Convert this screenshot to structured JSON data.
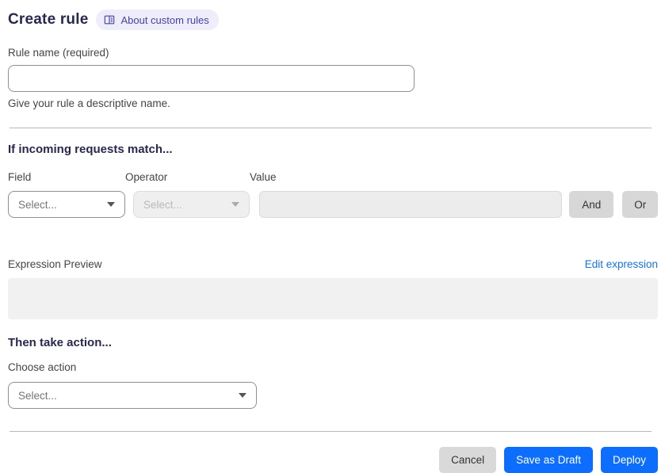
{
  "header": {
    "title": "Create rule",
    "about_badge": {
      "label": "About custom rules"
    }
  },
  "rule_name": {
    "label": "Rule name (required)",
    "value": "",
    "helper": "Give your rule a descriptive name."
  },
  "match_section": {
    "heading": "If incoming requests match...",
    "field": {
      "label": "Field",
      "selected": "Select..."
    },
    "operator": {
      "label": "Operator",
      "selected": "Select..."
    },
    "value": {
      "label": "Value",
      "value": ""
    },
    "and_button": "And",
    "or_button": "Or"
  },
  "expression": {
    "label": "Expression Preview",
    "edit_link": "Edit expression",
    "content": ""
  },
  "action_section": {
    "heading": "Then take action...",
    "choose_action": {
      "label": "Choose action",
      "selected": "Select..."
    }
  },
  "footer": {
    "cancel": "Cancel",
    "save_draft": "Save as Draft",
    "deploy": "Deploy"
  },
  "colors": {
    "primary_blue": "#0d6efd",
    "link_blue": "#1673e6",
    "badge_bg": "#eeedf9",
    "badge_text": "#4642a8",
    "heading_text": "#28284e"
  }
}
